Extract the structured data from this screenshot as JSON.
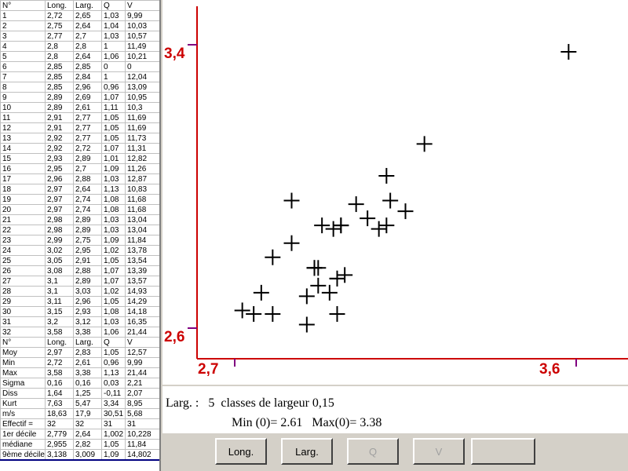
{
  "grid": {
    "headers": [
      "N°",
      "Long.",
      "Larg.",
      "Q",
      "V"
    ],
    "rows": [
      [
        "1",
        "2,72",
        "2,65",
        "1,03",
        "9,99"
      ],
      [
        "2",
        "2,75",
        "2,64",
        "1,04",
        "10,03"
      ],
      [
        "3",
        "2,77",
        "2,7",
        "1,03",
        "10,57"
      ],
      [
        "4",
        "2,8",
        "2,8",
        "1",
        "11,49"
      ],
      [
        "5",
        "2,8",
        "2,64",
        "1,06",
        "10,21"
      ],
      [
        "6",
        "2,85",
        "2,85",
        "0",
        "0"
      ],
      [
        "7",
        "2,85",
        "2,84",
        "1",
        "12,04"
      ],
      [
        "8",
        "2,85",
        "2,96",
        "0,96",
        "13,09"
      ],
      [
        "9",
        "2,89",
        "2,69",
        "1,07",
        "10,95"
      ],
      [
        "10",
        "2,89",
        "2,61",
        "1,11",
        "10,3"
      ],
      [
        "11",
        "2,91",
        "2,77",
        "1,05",
        "11,69"
      ],
      [
        "12",
        "2,91",
        "2,77",
        "1,05",
        "11,69"
      ],
      [
        "13",
        "2,92",
        "2,77",
        "1,05",
        "11,73"
      ],
      [
        "14",
        "2,92",
        "2,72",
        "1,07",
        "11,31"
      ],
      [
        "15",
        "2,93",
        "2,89",
        "1,01",
        "12,82"
      ],
      [
        "16",
        "2,95",
        "2,7",
        "1,09",
        "11,26"
      ],
      [
        "17",
        "2,96",
        "2,88",
        "1,03",
        "12,87"
      ],
      [
        "18",
        "2,97",
        "2,64",
        "1,13",
        "10,83"
      ],
      [
        "19",
        "2,97",
        "2,74",
        "1,08",
        "11,68"
      ],
      [
        "20",
        "2,97",
        "2,74",
        "1,08",
        "11,68"
      ],
      [
        "21",
        "2,98",
        "2,89",
        "1,03",
        "13,04"
      ],
      [
        "22",
        "2,98",
        "2,89",
        "1,03",
        "13,04"
      ],
      [
        "23",
        "2,99",
        "2,75",
        "1,09",
        "11,84"
      ],
      [
        "24",
        "3,02",
        "2,95",
        "1,02",
        "13,78"
      ],
      [
        "25",
        "3,05",
        "2,91",
        "1,05",
        "13,54"
      ],
      [
        "26",
        "3,08",
        "2,88",
        "1,07",
        "13,39"
      ],
      [
        "27",
        "3,1",
        "2,89",
        "1,07",
        "13,57"
      ],
      [
        "28",
        "3,1",
        "3,03",
        "1,02",
        "14,93"
      ],
      [
        "29",
        "3,11",
        "2,96",
        "1,05",
        "14,29"
      ],
      [
        "30",
        "3,15",
        "2,93",
        "1,08",
        "14,18"
      ],
      [
        "31",
        "3,2",
        "3,12",
        "1,03",
        "16,35"
      ],
      [
        "32",
        "3,58",
        "3,38",
        "1,06",
        "21,44"
      ]
    ],
    "stats_header": [
      "N°",
      "Long.",
      "Larg.",
      "Q",
      "V"
    ],
    "stats": [
      [
        "Moy",
        "2,97",
        "2,83",
        "1,05",
        "12,57"
      ],
      [
        "Min",
        "2,72",
        "2,61",
        "0,96",
        "9,99"
      ],
      [
        "Max",
        "3,58",
        "3,38",
        "1,13",
        "21,44"
      ],
      [
        "Sigma",
        "0,16",
        "0,16",
        "0,03",
        "2,21"
      ],
      [
        "Diss",
        "1,64",
        "1,25",
        "-0,11",
        "2,07"
      ],
      [
        "Kurt",
        "7,63",
        "5,47",
        "3,34",
        "8,95"
      ],
      [
        "m/s",
        "18,63",
        "17,9",
        "30,51",
        "5,68"
      ],
      [
        "Effectif =",
        "32",
        "32",
        "31",
        "31"
      ],
      [
        "1er décile",
        "2,779",
        "2,64",
        "1,002",
        "10,228"
      ],
      [
        "médiane",
        "2,955",
        "2,82",
        "1,05",
        "11,84"
      ],
      [
        "9ème décile",
        "3,138",
        "3,009",
        "1,09",
        "14,802"
      ]
    ]
  },
  "chart_data": {
    "type": "scatter",
    "x_ticks": [
      "2,7",
      "3,6"
    ],
    "y_ticks": [
      "3,4",
      "2,6"
    ],
    "xlim": [
      2.7,
      3.6
    ],
    "ylim": [
      2.6,
      3.4
    ],
    "points": [
      [
        2.72,
        2.65
      ],
      [
        2.75,
        2.64
      ],
      [
        2.77,
        2.7
      ],
      [
        2.8,
        2.8
      ],
      [
        2.8,
        2.64
      ],
      [
        2.85,
        2.84
      ],
      [
        2.85,
        2.96
      ],
      [
        2.89,
        2.69
      ],
      [
        2.89,
        2.61
      ],
      [
        2.91,
        2.77
      ],
      [
        2.91,
        2.77
      ],
      [
        2.92,
        2.77
      ],
      [
        2.92,
        2.72
      ],
      [
        2.93,
        2.89
      ],
      [
        2.95,
        2.7
      ],
      [
        2.96,
        2.88
      ],
      [
        2.97,
        2.64
      ],
      [
        2.97,
        2.74
      ],
      [
        2.97,
        2.74
      ],
      [
        2.98,
        2.89
      ],
      [
        2.98,
        2.89
      ],
      [
        2.99,
        2.75
      ],
      [
        3.02,
        2.95
      ],
      [
        3.05,
        2.91
      ],
      [
        3.08,
        2.88
      ],
      [
        3.1,
        2.89
      ],
      [
        3.1,
        3.03
      ],
      [
        3.11,
        2.96
      ],
      [
        3.15,
        2.93
      ],
      [
        3.2,
        3.12
      ],
      [
        3.58,
        3.38
      ]
    ],
    "colors": {
      "axis": "#cc0000",
      "tick_mark": "#800080",
      "marker": "#000000"
    }
  },
  "status": {
    "line1": "Larg. :   5  classes de largeur 0,15",
    "line2": "Min (0)= 2.61   Max(0)= 3.38"
  },
  "buttons": {
    "long_label": "Long.",
    "larg_label": "Larg.",
    "q_label": "Q",
    "v_label": "V",
    "blank_label": ""
  }
}
